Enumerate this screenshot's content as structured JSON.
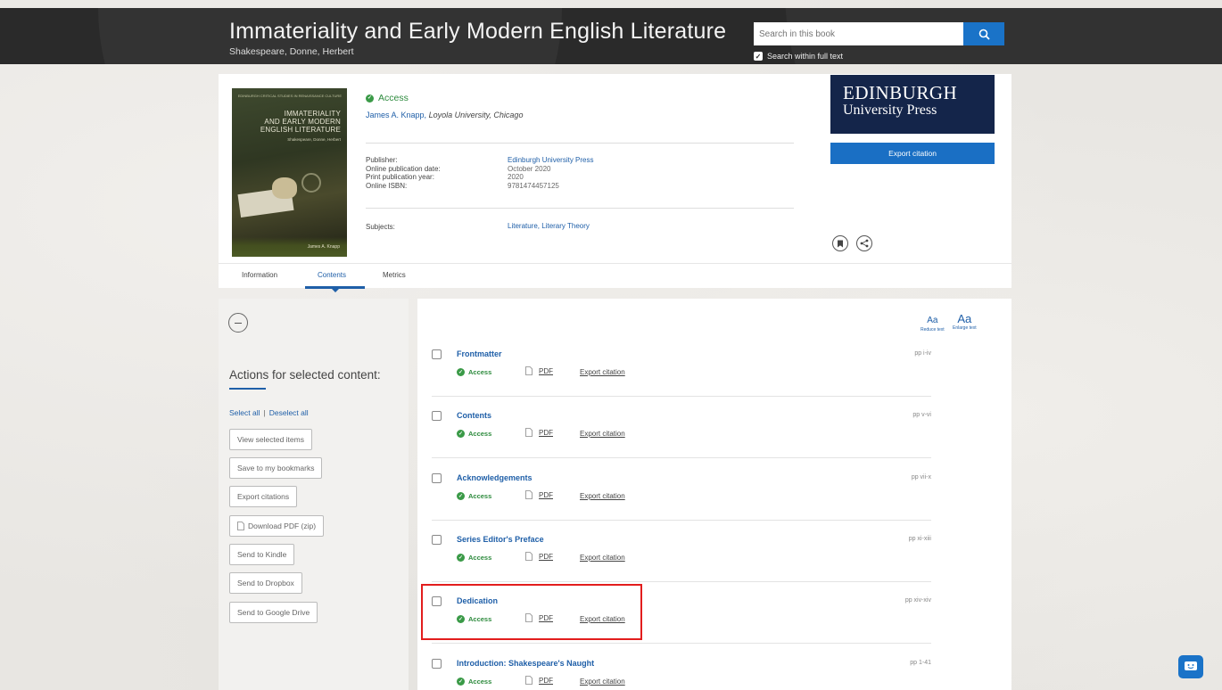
{
  "header": {
    "title": "Immateriality and Early Modern English Literature",
    "subtitle": "Shakespeare, Donne, Herbert",
    "search_placeholder": "Search in this book",
    "search_full_text": "Search within full text"
  },
  "book": {
    "cover_series": "EDINBURGH CRITICAL STUDIES IN RENAISSANCE CULTURE",
    "cover_title_1": "IMMATERIALITY",
    "cover_title_2": "AND EARLY MODERN",
    "cover_title_3": "ENGLISH LITERATURE",
    "cover_subtitle": "Shakespeare, Donne, Herbert",
    "cover_author": "James A. Knapp",
    "access": "Access",
    "author": "James A. Knapp",
    "affiliation": "Loyola University, Chicago",
    "meta_labels": [
      "Publisher:",
      "Online publication date:",
      "Print publication year:",
      "Online ISBN:"
    ],
    "publisher": "Edinburgh University Press",
    "online_date": "October 2020",
    "print_year": "2020",
    "isbn": "9781474457125",
    "subjects_label": "Subjects:",
    "subjects": "Literature, Literary Theory"
  },
  "publisher_logo": {
    "line1": "EDINBURGH",
    "line2": "University Press"
  },
  "export_citation_button": "Export citation",
  "tabs": [
    {
      "label": "Information"
    },
    {
      "label": "Contents"
    },
    {
      "label": "Metrics"
    }
  ],
  "actions": {
    "title": "Actions for selected content:",
    "select_all": "Select all",
    "separator": "|",
    "deselect_all": "Deselect all",
    "buttons": [
      "View selected items",
      "Save to my bookmarks",
      "Export citations",
      "Download PDF (zip)",
      "Send to Kindle",
      "Send to Dropbox",
      "Send to Google Drive"
    ]
  },
  "text_size": {
    "reduce_glyph": "Aa",
    "reduce_label": "Reduce text",
    "enlarge_glyph": "Aa",
    "enlarge_label": "Enlarge text"
  },
  "contents": [
    {
      "title": "Frontmatter",
      "pages": "pp i-iv",
      "access": "Access",
      "pdf": "PDF",
      "cite": "Export citation"
    },
    {
      "title": "Contents",
      "pages": "pp v-vi",
      "access": "Access",
      "pdf": "PDF",
      "cite": "Export citation"
    },
    {
      "title": "Acknowledgements",
      "pages": "pp vii-x",
      "access": "Access",
      "pdf": "PDF",
      "cite": "Export citation"
    },
    {
      "title": "Series Editor's Preface",
      "pages": "pp xi-xiii",
      "access": "Access",
      "pdf": "PDF",
      "cite": "Export citation"
    },
    {
      "title": "Dedication",
      "pages": "pp xiv-xiv",
      "access": "Access",
      "pdf": "PDF",
      "cite": "Export citation"
    },
    {
      "title": "Introduction: Shakespeare's Naught",
      "pages": "pp 1-41",
      "access": "Access",
      "pdf": "PDF",
      "cite": "Export citation"
    }
  ],
  "colors": {
    "accent": "#1f5fa8",
    "access_green": "#3a9a47",
    "header_bg": "#2a2a2a",
    "highlight": "#e21d1d"
  }
}
